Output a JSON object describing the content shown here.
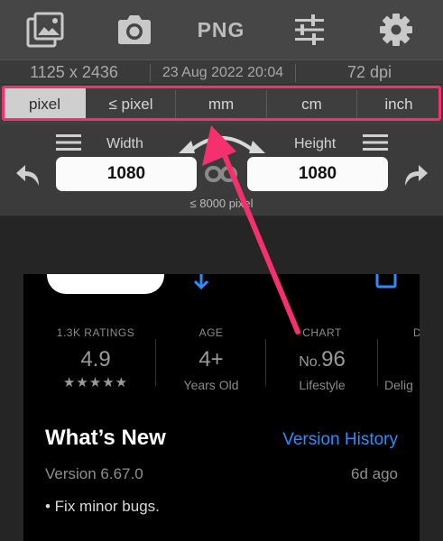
{
  "toolbar": {
    "items": [
      "gallery-icon",
      "camera-icon",
      "PNG",
      "sliders-icon",
      "gear-icon"
    ],
    "format_label": "PNG"
  },
  "info": {
    "dimensions": "1125 x 2436",
    "date": "23 Aug 2022 20:04",
    "dpi": "72 dpi"
  },
  "units": {
    "options": [
      "pixel",
      "≤ pixel",
      "mm",
      "cm",
      "inch"
    ],
    "selected": "pixel"
  },
  "size": {
    "width_label": "Width",
    "height_label": "Height",
    "width_value": "1080",
    "height_value": "1080",
    "limit": "≤ 8000 pixel"
  },
  "app_store": {
    "stats": [
      {
        "head": "1.3K RATINGS",
        "value": "4.9",
        "sub": "★★★★★"
      },
      {
        "head": "AGE",
        "value": "4+",
        "sub": "Years Old"
      },
      {
        "head": "CHART",
        "value_prefix": "No.",
        "value": "96",
        "sub": "Lifestyle"
      },
      {
        "head": "D",
        "value": "",
        "sub": "Delig"
      }
    ],
    "whats_new": "What’s New",
    "version_history": "Version History",
    "version": "Version 6.67.0",
    "ago": "6d ago",
    "note": "• Fix minor bugs."
  },
  "colors": {
    "highlight": "#f5306f",
    "link": "#2f8cff"
  }
}
